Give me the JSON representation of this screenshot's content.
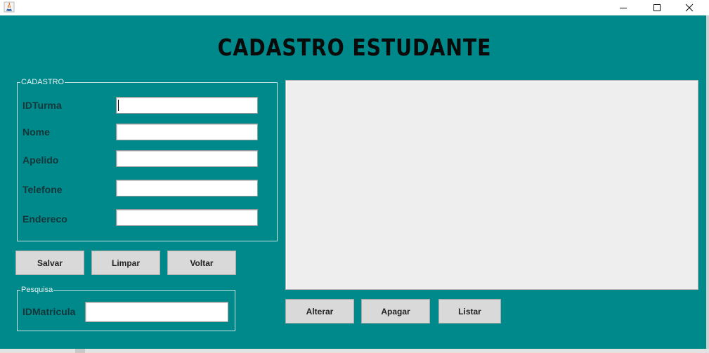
{
  "window": {
    "title": ""
  },
  "header": {
    "title": "CADASTRO ESTUDANTE"
  },
  "cadastro": {
    "legend": "CADASTRO",
    "fields": [
      {
        "label": "IDTurma",
        "value": ""
      },
      {
        "label": "Nome",
        "value": ""
      },
      {
        "label": "Apelido",
        "value": ""
      },
      {
        "label": "Telefone",
        "value": ""
      },
      {
        "label": "Endereco",
        "value": ""
      }
    ]
  },
  "actions": {
    "save": "Salvar",
    "clear": "Limpar",
    "back": "Voltar"
  },
  "pesquisa": {
    "legend": "Pesquisa",
    "label": "IDMatricula",
    "value": ""
  },
  "table_actions": {
    "edit": "Alterar",
    "delete": "Apagar",
    "list": "Listar"
  },
  "colors": {
    "background": "#00898a",
    "button": "#d9d9d9",
    "table": "#eeeeee"
  }
}
